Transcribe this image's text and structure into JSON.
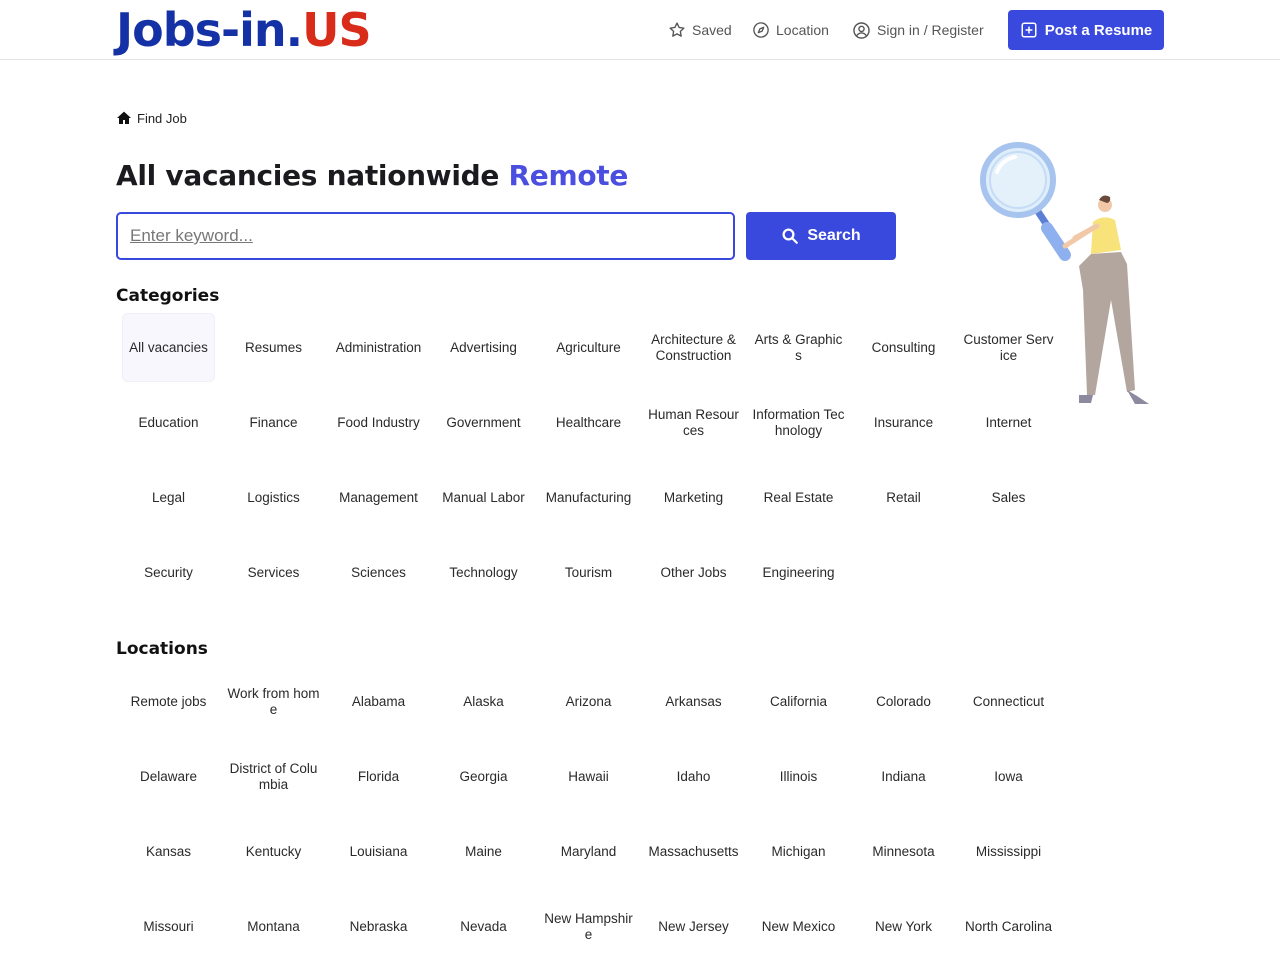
{
  "header": {
    "logo_part1": "Jobs-in.",
    "logo_part2": "US",
    "nav": {
      "saved": "Saved",
      "location": "Location",
      "signin": "Sign in / Register"
    },
    "post_resume": "Post a Resume"
  },
  "breadcrumb": {
    "label": "Find Job"
  },
  "title": {
    "main": "All vacancies nationwide ",
    "highlight": "Remote"
  },
  "search": {
    "placeholder": "Enter keyword...",
    "value": "",
    "button": "Search"
  },
  "categories": {
    "title": "Categories",
    "items": [
      "All vacancies",
      "Resumes",
      "Administration",
      "Advertising",
      "Agriculture",
      "Architecture & Construction",
      "Arts & Graphics",
      "Consulting",
      "Customer Service",
      "Education",
      "Finance",
      "Food Industry",
      "Government",
      "Healthcare",
      "Human Resources",
      "Information Technology",
      "Insurance",
      "Internet",
      "Legal",
      "Logistics",
      "Management",
      "Manual Labor",
      "Manufacturing",
      "Marketing",
      "Real Estate",
      "Retail",
      "Sales",
      "Security",
      "Services",
      "Sciences",
      "Technology",
      "Tourism",
      "Other Jobs",
      "Engineering"
    ]
  },
  "locations": {
    "title": "Locations",
    "items": [
      "Remote jobs",
      "Work from home",
      "Alabama",
      "Alaska",
      "Arizona",
      "Arkansas",
      "California",
      "Colorado",
      "Connecticut",
      "Delaware",
      "District of Columbia",
      "Florida",
      "Georgia",
      "Hawaii",
      "Idaho",
      "Illinois",
      "Indiana",
      "Iowa",
      "Kansas",
      "Kentucky",
      "Louisiana",
      "Maine",
      "Maryland",
      "Massachusetts",
      "Michigan",
      "Minnesota",
      "Mississippi",
      "Missouri",
      "Montana",
      "Nebraska",
      "Nevada",
      "New Hampshire",
      "New Jersey",
      "New Mexico",
      "New York",
      "North Carolina"
    ]
  },
  "colors": {
    "accent": "#3a49dd",
    "highlight": "#4b4fe0",
    "logo_blue": "#1531a6",
    "logo_red": "#d92b1a"
  }
}
